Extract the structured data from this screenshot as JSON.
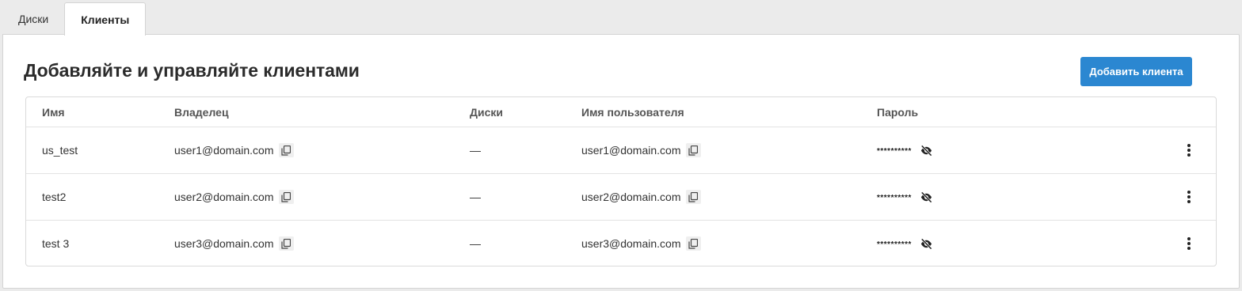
{
  "tabs": [
    {
      "label": "Диски",
      "active": false
    },
    {
      "label": "Клиенты",
      "active": true
    }
  ],
  "page": {
    "title": "Добавляйте и управляйте клиентами",
    "add_button": "Добавить клиента"
  },
  "table": {
    "headers": {
      "name": "Имя",
      "owner": "Владелец",
      "disks": "Диски",
      "username": "Имя пользователя",
      "password": "Пароль"
    },
    "rows": [
      {
        "name": "us_test",
        "owner": "user1@domain.com",
        "disks": "—",
        "username": "user1@domain.com",
        "password": "**********"
      },
      {
        "name": "test2",
        "owner": "user2@domain.com",
        "disks": "—",
        "username": "user2@domain.com",
        "password": "**********"
      },
      {
        "name": "test 3",
        "owner": "user3@domain.com",
        "disks": "—",
        "username": "user3@domain.com",
        "password": "**********"
      }
    ]
  },
  "icons": {
    "copy": "copy-icon",
    "visibility_off": "eye-off-icon",
    "more": "more-vertical-icon"
  },
  "colors": {
    "accent": "#2b87d1",
    "background": "#ebebeb",
    "panel": "#ffffff"
  }
}
